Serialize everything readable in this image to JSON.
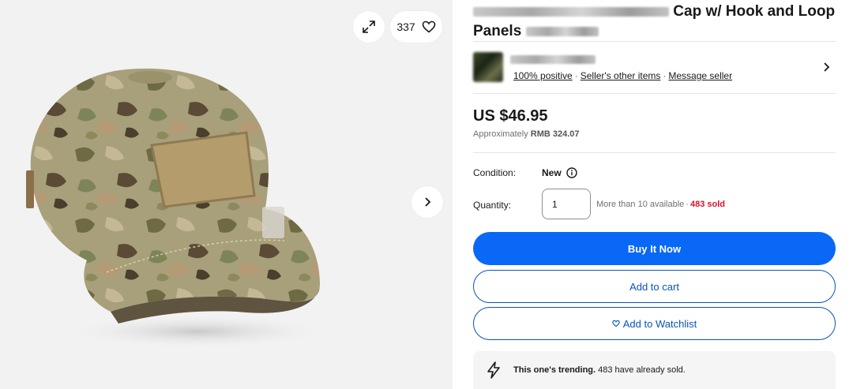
{
  "gallery": {
    "watch_count": "337",
    "icons": {
      "expand": "expand-icon",
      "heart": "heart-icon",
      "next": "chevron-right-icon"
    }
  },
  "listing": {
    "title_visible": "Cap w/ Hook and Loop",
    "title_line2": "Panels"
  },
  "seller": {
    "feedback": "100% positive",
    "other_items": "Seller's other items",
    "message": "Message seller",
    "separator": "·"
  },
  "price": {
    "amount": "US $46.95",
    "approx_prefix": "Approximately",
    "approx_value": "RMB 324.07"
  },
  "condition": {
    "label": "Condition:",
    "value": "New"
  },
  "quantity": {
    "label": "Quantity:",
    "value": "1",
    "available": "More than 10 available",
    "dot": "·",
    "sold": "483 sold"
  },
  "actions": {
    "buy_now": "Buy It Now",
    "add_to_cart": "Add to cart",
    "add_to_watchlist": "Add to Watchlist"
  },
  "trending": {
    "bold": "This one's trending.",
    "rest": "483 have already sold."
  },
  "colors": {
    "accent_blue": "#0968f6",
    "link_blue": "#0654ba",
    "sold_red": "#e0102a"
  }
}
